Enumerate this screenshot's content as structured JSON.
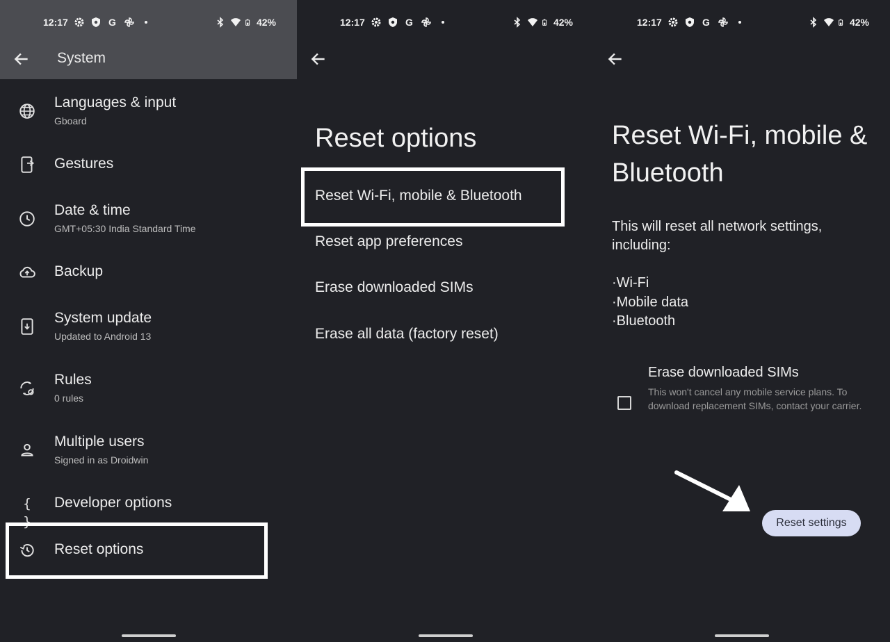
{
  "status": {
    "time": "12:17",
    "battery": "42%",
    "icons_left": [
      "gear-icon",
      "shield-icon",
      "google-g-icon",
      "pinwheel-icon",
      "dot-icon"
    ],
    "icons_right": [
      "bluetooth-icon",
      "wifi-icon",
      "battery-icon"
    ]
  },
  "panel1": {
    "title": "System",
    "items": [
      {
        "title": "Languages & input",
        "subtitle": "Gboard",
        "icon": "globe-icon"
      },
      {
        "title": "Gestures",
        "subtitle": "",
        "icon": "phone-gesture-icon"
      },
      {
        "title": "Date & time",
        "subtitle": "GMT+05:30 India Standard Time",
        "icon": "clock-icon"
      },
      {
        "title": "Backup",
        "subtitle": "",
        "icon": "cloud-upload-icon"
      },
      {
        "title": "System update",
        "subtitle": "Updated to Android 13",
        "icon": "system-update-icon"
      },
      {
        "title": "Rules",
        "subtitle": "0 rules",
        "icon": "rules-icon"
      },
      {
        "title": "Multiple users",
        "subtitle": "Signed in as Droidwin",
        "icon": "person-icon"
      },
      {
        "title": "Developer options",
        "subtitle": "",
        "icon": "braces-icon",
        "glyph": "{ }"
      },
      {
        "title": "Reset options",
        "subtitle": "",
        "icon": "history-icon"
      }
    ]
  },
  "panel2": {
    "title": "Reset options",
    "options": [
      "Reset Wi-Fi, mobile & Bluetooth",
      "Reset app preferences",
      "Erase downloaded SIMs",
      "Erase all data (factory reset)"
    ]
  },
  "panel3": {
    "title_line1": "Reset Wi-Fi, mobile &",
    "title_line2": "Bluetooth",
    "description": "This will reset all network settings, including:",
    "bullets": [
      "·Wi-Fi",
      "·Mobile data",
      "·Bluetooth"
    ],
    "checkbox": {
      "title": "Erase downloaded SIMs",
      "description": "This won't cancel any mobile service plans. To download replacement SIMs, contact your carrier.",
      "checked": false
    },
    "button": "Reset settings"
  },
  "colors": {
    "background": "#202126",
    "appbar": "#4b4c51",
    "button": "#d7dcf3",
    "highlight": "#ffffff"
  }
}
